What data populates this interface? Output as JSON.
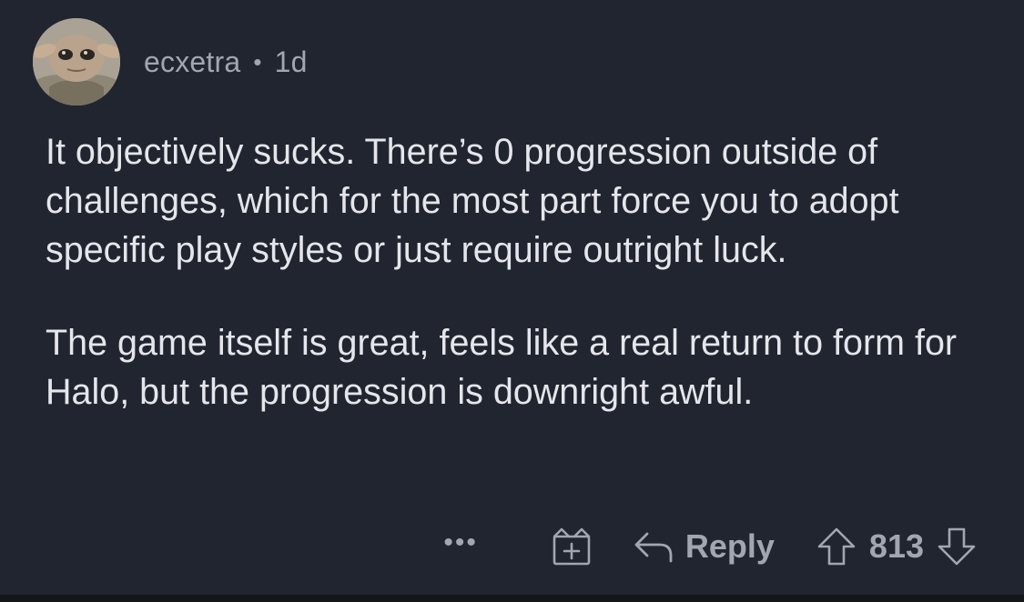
{
  "comment": {
    "author": "ecxetra",
    "separator": "•",
    "age": "1d",
    "avatar_icon": "baby-yoda-avatar",
    "paragraphs": [
      "It objectively sucks. There’s 0 progression outside of challenges, which for the most part force you to adopt specific play styles or just require outright luck.",
      "The game itself is great, feels like a real return to form for Halo, but the progression is downright awful."
    ]
  },
  "actions": {
    "more_label": "•••",
    "award_icon": "gift-plus-icon",
    "reply_icon": "reply-arrow-icon",
    "reply_label": "Reply",
    "upvote_icon": "upvote-arrow-icon",
    "score": "813",
    "downvote_icon": "downvote-arrow-icon"
  },
  "colors": {
    "background": "#212530",
    "text": "#e4e6ea",
    "muted": "#a2a6ae"
  }
}
